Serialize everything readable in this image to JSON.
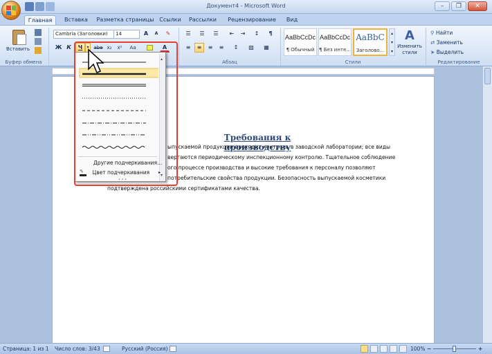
{
  "window": {
    "title": "Документ4 - Microsoft Word",
    "minimize": "–",
    "restore": "❐",
    "close": "✕"
  },
  "tabs": [
    {
      "label": "Главная",
      "active": true
    },
    {
      "label": "Вставка"
    },
    {
      "label": "Разметка страницы"
    },
    {
      "label": "Ссылки"
    },
    {
      "label": "Рассылки"
    },
    {
      "label": "Рецензирование"
    },
    {
      "label": "Вид"
    }
  ],
  "ribbon": {
    "clipboard": {
      "paste_label": "Вставить",
      "group": "Буфер обмена"
    },
    "font": {
      "name": "Cambria (Заголовки)",
      "size": "14",
      "bold": "Ж",
      "italic": "К",
      "underline": "Ч",
      "strike": "abe",
      "subscript": "x₂",
      "superscript": "x²",
      "change_case": "Aa",
      "grow": "A",
      "shrink": "A"
    },
    "paragraph": {
      "group": "Абзац"
    },
    "styles": {
      "group": "Стили",
      "items": [
        {
          "sample": "AaBbCcDc",
          "name": "¶ Обычный"
        },
        {
          "sample": "AaBbCcDc",
          "name": "¶ Без инте..."
        },
        {
          "sample": "AaBbC",
          "name": "Заголово..."
        }
      ],
      "change_label": "Изменить стили"
    },
    "editing": {
      "group": "Редактирование",
      "find": "Найти",
      "replace": "Заменить",
      "select": "Выделить"
    }
  },
  "underline_menu": {
    "styles": [
      "single",
      "thick-selected",
      "double",
      "dotted",
      "dashed",
      "dash-dot",
      "dash-dot-dot",
      "wave"
    ],
    "more": "Другие подчеркивания...",
    "color": "Цвет подчеркивания"
  },
  "document": {
    "title": "Требования к производству",
    "lines": [
      "ыпускаемой продукции проходит контроль в заводской лаборатории; все виды",
      "вергаются периодическому инспекционному контролю. Тщательное соблюдение",
      "ого процессе производства и высокие требования к персоналу позволяют",
      "потребительские свойства продукции. Безопасность выпускаемой косметики",
      "подтверждена российскими сертификатами качества."
    ]
  },
  "status": {
    "page": "Страница: 1 из 1",
    "words": "Число слов: 3/43",
    "language": "Русский (Россия)",
    "zoom": "100%"
  },
  "colors": {
    "ribbon_bg": "#dce8f7",
    "highlight_frame": "#e53f32",
    "heading_color": "#2f4a7b"
  }
}
